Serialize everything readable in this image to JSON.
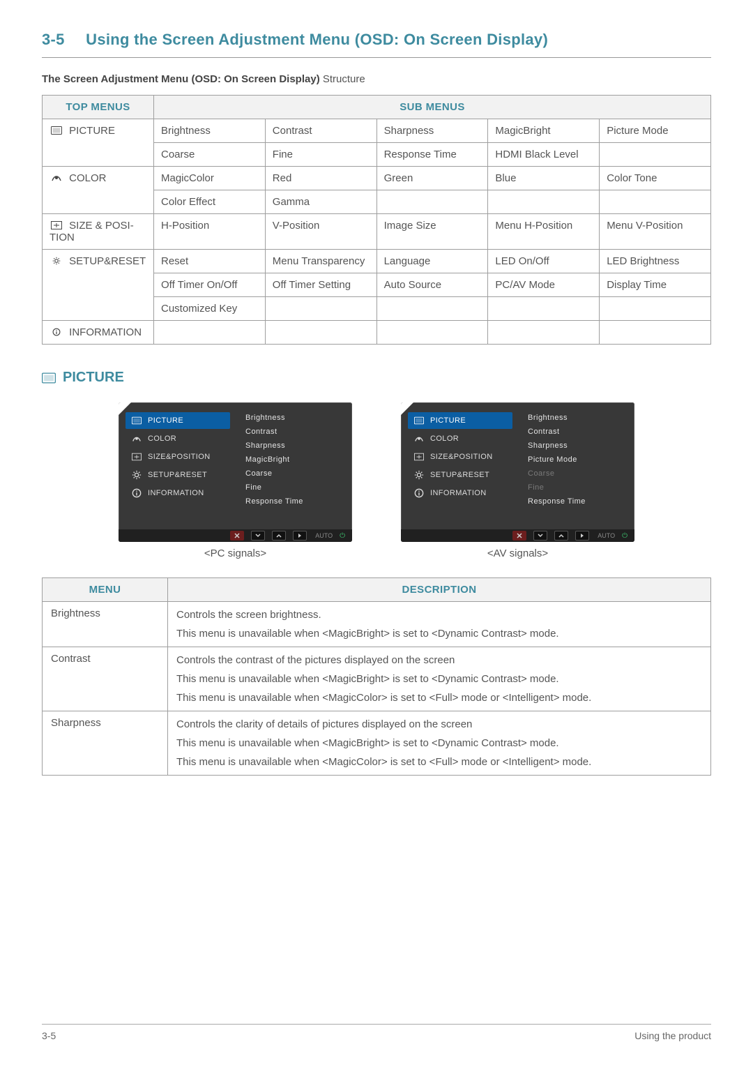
{
  "page": {
    "section_number": "3-5",
    "title": "Using the Screen Adjustment Menu (OSD: On Screen Display)",
    "subtitle_bold": "The Screen Adjustment Menu (OSD: On Screen Display)",
    "subtitle_rest": " Structure",
    "footer_left": "3-5",
    "footer_right": "Using the product"
  },
  "structure_table": {
    "header_top": "TOP MENUS",
    "header_sub": "SUB MENUS",
    "rows": [
      {
        "top": " PICTURE",
        "icon": "picture",
        "subs": [
          "Brightness",
          "Contrast",
          "Sharpness",
          "MagicBright",
          "Picture Mode",
          "Coarse",
          "Fine",
          "Response Time",
          "HDMI Black Level",
          ""
        ]
      },
      {
        "top": " COLOR",
        "icon": "color",
        "subs": [
          "MagicColor",
          "Red",
          "Green",
          "Blue",
          "Color Tone",
          "Color Effect",
          "Gamma",
          "",
          "",
          ""
        ]
      },
      {
        "top": " SIZE & POSI­TION",
        "icon": "sizepos",
        "subs": [
          "H-Position",
          "V-Position",
          "Image Size",
          "Menu H-Position",
          "Menu V-Position"
        ]
      },
      {
        "top": " SETUP&RESET",
        "icon": "setup",
        "subs": [
          "Reset",
          "Menu Transpar­ency",
          "Language",
          "LED On/Off",
          "LED Brightness",
          "Off Timer On/Off",
          "Off Timer Setting",
          "Auto Source",
          "PC/AV Mode",
          "Display Time",
          "Customized Key",
          "",
          "",
          "",
          ""
        ]
      },
      {
        "top": " INFORMA­TION",
        "icon": "info",
        "subs": [
          "",
          "",
          "",
          "",
          ""
        ]
      }
    ]
  },
  "section_heading": "PICTURE",
  "osd_panels": {
    "caption_pc": "<PC signals>",
    "caption_av": "<AV signals>",
    "menu_items": [
      {
        "label": "PICTURE",
        "icon": "picture"
      },
      {
        "label": "COLOR",
        "icon": "color"
      },
      {
        "label": "SIZE&POSITION",
        "icon": "sizepos"
      },
      {
        "label": "SETUP&RESET",
        "icon": "setup"
      },
      {
        "label": "INFORMATION",
        "icon": "info"
      }
    ],
    "right_pc": [
      "Brightness",
      "Contrast",
      "Sharpness",
      "MagicBright",
      "Coarse",
      "Fine",
      "Response Time"
    ],
    "right_av": [
      {
        "t": "Brightness",
        "dim": false
      },
      {
        "t": "Contrast",
        "dim": false
      },
      {
        "t": "Sharpness",
        "dim": false
      },
      {
        "t": "Picture Mode",
        "dim": false
      },
      {
        "t": "Coarse",
        "dim": true
      },
      {
        "t": "Fine",
        "dim": true
      },
      {
        "t": "Response Time",
        "dim": false
      }
    ],
    "bar_auto": "AUTO"
  },
  "description_table": {
    "header_menu": "MENU",
    "header_desc": "DESCRIPTION",
    "rows": [
      {
        "menu": "Brightness",
        "desc": [
          "Controls the screen brightness.",
          "This menu is unavailable when <MagicBright> is set to <Dynamic Contrast> mode."
        ]
      },
      {
        "menu": "Contrast",
        "desc": [
          "Controls the contrast of the pictures displayed on the screen",
          "This menu is unavailable when <MagicBright> is set to <Dynamic Contrast> mode.",
          "This menu is unavailable when <MagicColor> is set to <Full> mode or <Intelligent> mode."
        ]
      },
      {
        "menu": "Sharpness",
        "desc": [
          "Controls the clarity of details of pictures displayed on the screen",
          "This menu is unavailable when <MagicBright> is set to <Dynamic Contrast> mode.",
          "This menu is unavailable when <MagicColor> is set to <Full> mode or <Intelligent> mode."
        ]
      }
    ]
  },
  "icons": {
    "picture": "picture-icon",
    "color": "color-icon",
    "sizepos": "sizepos-icon",
    "setup": "setup-icon",
    "info": "info-icon"
  }
}
